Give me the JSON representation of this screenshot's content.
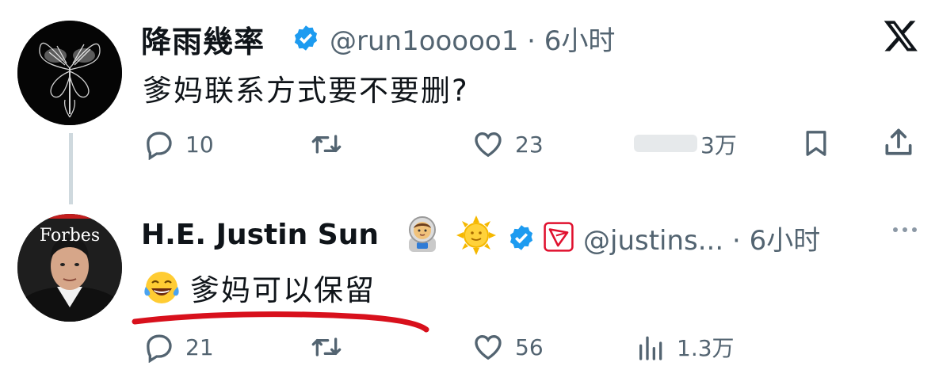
{
  "close_button": {
    "label": "𝕏"
  },
  "tweet1": {
    "name": "降雨幾率",
    "handle": "@run1ooooo1",
    "separator": "·",
    "time": "6小时",
    "text": "爹妈联系方式要不要删?",
    "actions": {
      "reply_count": "10",
      "retweet_count": "",
      "like_count": "23",
      "views_count": "3万"
    }
  },
  "tweet2": {
    "name": "H.E. Justin Sun",
    "handle": "@justins...",
    "separator": "·",
    "time": "6小时",
    "avatar_text": "Forbes",
    "text": "爹妈可以保留",
    "actions": {
      "reply_count": "21",
      "retweet_count": "",
      "like_count": "56",
      "views_count": "1.3万"
    }
  },
  "colors": {
    "text": "#0f1419",
    "secondary": "#536471",
    "verified": "#1d9bf0",
    "tron": "#e0102e",
    "underline": "#d8101c"
  },
  "icons": [
    "reply-icon",
    "retweet-icon",
    "like-icon",
    "views-icon",
    "bookmark-icon",
    "share-icon",
    "verified-icon",
    "x-logo-icon",
    "tron-icon",
    "more-icon",
    "astronaut-emoji",
    "sun-emoji",
    "laughing-emoji"
  ]
}
